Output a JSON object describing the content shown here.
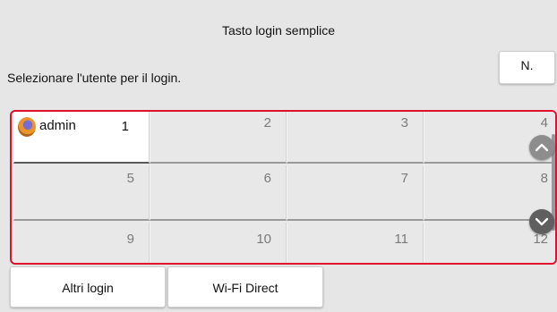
{
  "header": {
    "title": "Tasto login semplice",
    "subtitle": "Selezionare l'utente per il login.",
    "n_button": "N."
  },
  "users": [
    {
      "num": "1",
      "name": "admin",
      "selected": true
    },
    {
      "num": "2"
    },
    {
      "num": "3"
    },
    {
      "num": "4"
    },
    {
      "num": "5"
    },
    {
      "num": "6"
    },
    {
      "num": "7"
    },
    {
      "num": "8"
    },
    {
      "num": "9"
    },
    {
      "num": "10"
    },
    {
      "num": "11"
    },
    {
      "num": "12"
    }
  ],
  "footer": {
    "other_login": "Altri login",
    "wifi_direct": "Wi-Fi Direct"
  },
  "colors": {
    "highlight_border": "#e0102b"
  },
  "icons": {
    "scroll_up": "chevron-up-icon",
    "scroll_down": "chevron-down-icon",
    "avatar": "user-avatar-icon"
  }
}
